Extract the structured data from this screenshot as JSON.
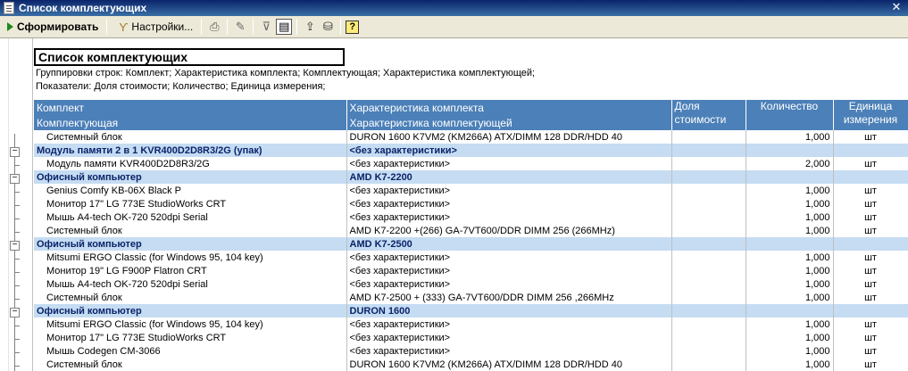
{
  "window": {
    "title": "Список комплектующих"
  },
  "toolbar": {
    "generate_label": "Сформировать",
    "settings_label": "Настройки..."
  },
  "report": {
    "title": "Список комплектующих",
    "groupings": "Группировки строк: Комплект; Характеристика комплекта; Комплектующая; Характеристика комплектующей;",
    "indicators": "Показатели: Доля стоимости; Количество; Единица измерения;"
  },
  "headers": {
    "kit": "Комплект",
    "component": "Комплектующая",
    "kit_char": "Характеристика комплекта",
    "comp_char": "Характеристика комплектующей",
    "cost_share": "Доля стоимости",
    "quantity": "Количество",
    "unit": "Единица измерения"
  },
  "rows": [
    {
      "type": "item",
      "name": "Системный блок",
      "char": "DURON 1600  K7VM2 (KM266A) ATX/DIMM 128 DDR/HDD 40",
      "qty": "1,000",
      "unit": "шт"
    },
    {
      "type": "group",
      "name": "Модуль памяти 2 в 1 KVR400D2D8R3/2G (упак)",
      "char": "<без характеристики>"
    },
    {
      "type": "item",
      "name": "Модуль памяти KVR400D2D8R3/2G",
      "char": "<без характеристики>",
      "qty": "2,000",
      "unit": "шт"
    },
    {
      "type": "group",
      "name": "Офисный компьютер",
      "char": "AMD K7-2200"
    },
    {
      "type": "item",
      "name": "Genius Comfy KB-06X Black P",
      "char": "<без характеристики>",
      "qty": "1,000",
      "unit": "шт"
    },
    {
      "type": "item",
      "name": "Монитор 17\" LG 773E StudioWorks CRT",
      "char": "<без характеристики>",
      "qty": "1,000",
      "unit": "шт"
    },
    {
      "type": "item",
      "name": "Мышь A4-tech OK-720 520dpi Serial",
      "char": "<без характеристики>",
      "qty": "1,000",
      "unit": "шт"
    },
    {
      "type": "item",
      "name": "Системный блок",
      "char": "AMD K7-2200 +(266) GA-7VT600/DDR DIMM 256 (266MHz)",
      "qty": "1,000",
      "unit": "шт"
    },
    {
      "type": "group",
      "name": "Офисный компьютер",
      "char": "AMD K7-2500"
    },
    {
      "type": "item",
      "name": "Mitsumi ERGO Classic (for Windows 95, 104 key)",
      "char": "<без характеристики>",
      "qty": "1,000",
      "unit": "шт"
    },
    {
      "type": "item",
      "name": "Монитор 19\" LG F900P Flatron CRT",
      "char": "<без характеристики>",
      "qty": "1,000",
      "unit": "шт"
    },
    {
      "type": "item",
      "name": "Мышь A4-tech OK-720 520dpi Serial",
      "char": "<без характеристики>",
      "qty": "1,000",
      "unit": "шт"
    },
    {
      "type": "item",
      "name": "Системный блок",
      "char": "AMD K7-2500 + (333) GA-7VT600/DDR DIMM 256 ,266MHz",
      "qty": "1,000",
      "unit": "шт"
    },
    {
      "type": "group",
      "name": "Офисный компьютер",
      "char": "DURON 1600"
    },
    {
      "type": "item",
      "name": "Mitsumi ERGO Classic (for Windows 95, 104 key)",
      "char": "<без характеристики>",
      "qty": "1,000",
      "unit": "шт"
    },
    {
      "type": "item",
      "name": "Монитор 17\" LG 773E StudioWorks CRT",
      "char": "<без характеристики>",
      "qty": "1,000",
      "unit": "шт"
    },
    {
      "type": "item",
      "name": "Мышь Codegen CM-3066",
      "char": "<без характеристики>",
      "qty": "1,000",
      "unit": "шт"
    },
    {
      "type": "item",
      "name": "Системный блок",
      "char": "DURON 1600  K7VM2 (KM266A) ATX/DIMM 128 DDR/HDD 40",
      "qty": "1,000",
      "unit": "шт"
    }
  ]
}
